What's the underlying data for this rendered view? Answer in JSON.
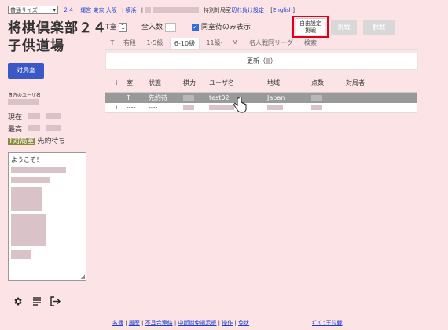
{
  "topbar": {
    "size_select": "普通サイズ",
    "links": [
      "２４",
      "運営",
      "東京",
      "大阪",
      "横浜"
    ],
    "special_label": "特別対局室",
    "special_link": "切れ負け設定",
    "lang_link": "English"
  },
  "site_title_line1": "将棋倶楽部２４",
  "site_title_line2": "子供道場",
  "controls": {
    "t_room_label": "T室",
    "t_room_value": "1",
    "all_count_label": "全入数",
    "waiting_only_label": "同室待のみ表示",
    "waiting_only_checked": true,
    "free_setting_line1": "自由設定",
    "free_setting_line2": "挑戦",
    "challenge_label": "挑戦",
    "spectate_label": "観戦"
  },
  "tabs": [
    "T",
    "有段",
    "1-5級",
    "6-10級",
    "11級-",
    "M",
    "名人戦同リーグ",
    "検索"
  ],
  "active_tab": 3,
  "refresh_label": "更新（",
  "refresh_suffix": "）",
  "table": {
    "headers": [
      "i",
      "室",
      "状態",
      "棋力",
      "ユーザ名",
      "地域",
      "点数",
      "対局者"
    ],
    "rows": [
      {
        "i": "",
        "room": "T",
        "status": "先約待",
        "user": "test02",
        "region": "Japan",
        "highlight": true
      },
      {
        "i": "i",
        "room": "----",
        "status": "----",
        "user": "",
        "region": "",
        "highlight": false
      }
    ]
  },
  "sidebar": {
    "play_room_button": "対局室",
    "your_user_label": "貴方のユーザ名",
    "current_label": "現在",
    "best_label": "最高",
    "room_badge": "T対局室",
    "room_status": "先約待ち",
    "chat_text": "ようこそ！"
  },
  "icons": [
    "gear-icon",
    "list-icon",
    "logout-icon"
  ],
  "footer": {
    "links": [
      "名簿",
      "履歴",
      "不具合連絡",
      "中断御免掲示板",
      "操作",
      "免状"
    ],
    "right_link": "ｷﾞﾊﾞﾗ王位戦"
  },
  "colors": {
    "background": "#fbe3e6",
    "accent_blue": "#3a59c7",
    "row_highlight": "#999999",
    "highlight_box": "#e0001b"
  }
}
